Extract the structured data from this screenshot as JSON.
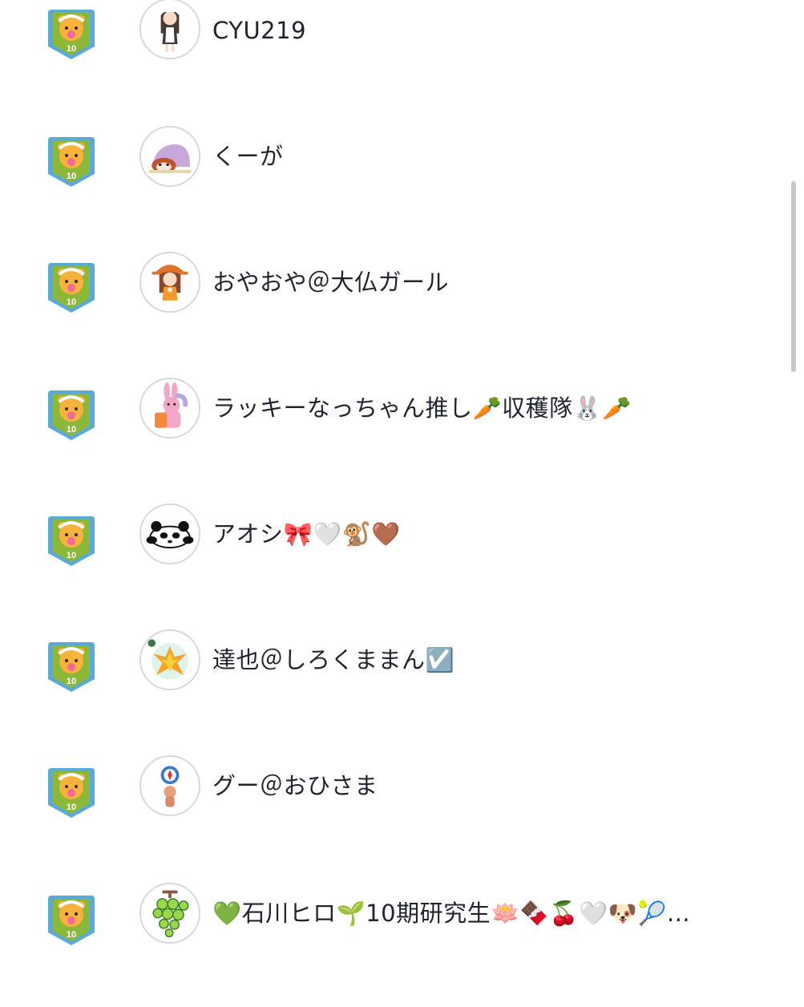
{
  "badge_level": "10",
  "users": [
    {
      "name": "CYU219",
      "avatar": "girl-maid-avatar"
    },
    {
      "name": "くーが",
      "avatar": "red-panda-blanket-avatar"
    },
    {
      "name": "おやおや＠大仏ガール",
      "avatar": "girl-orange-hat-avatar"
    },
    {
      "name": "ラッキーなっちゃん推し🥕収穫隊🐰🥕",
      "avatar": "pink-bunny-avatar"
    },
    {
      "name": "アオシ🎀🤍🐒🤎",
      "avatar": "panda-avatar"
    },
    {
      "name": "達也＠しろくままん☑️",
      "avatar": "phoenix-avatar"
    },
    {
      "name": "グー＠おひさま",
      "avatar": "compass-character-avatar"
    },
    {
      "name": "💚石川ヒロ🌱10期研究生🪷🍫🍒🤍🐶🎾…",
      "avatar": "grape-avatar"
    }
  ],
  "colors": {
    "badge_shield": "#8cb83a",
    "badge_border": "#5aa9d6",
    "bear": "#f7b23b",
    "text": "#1f2430",
    "avatar_border": "#d8d8d8",
    "scrollbar": "#c7c7c7"
  }
}
